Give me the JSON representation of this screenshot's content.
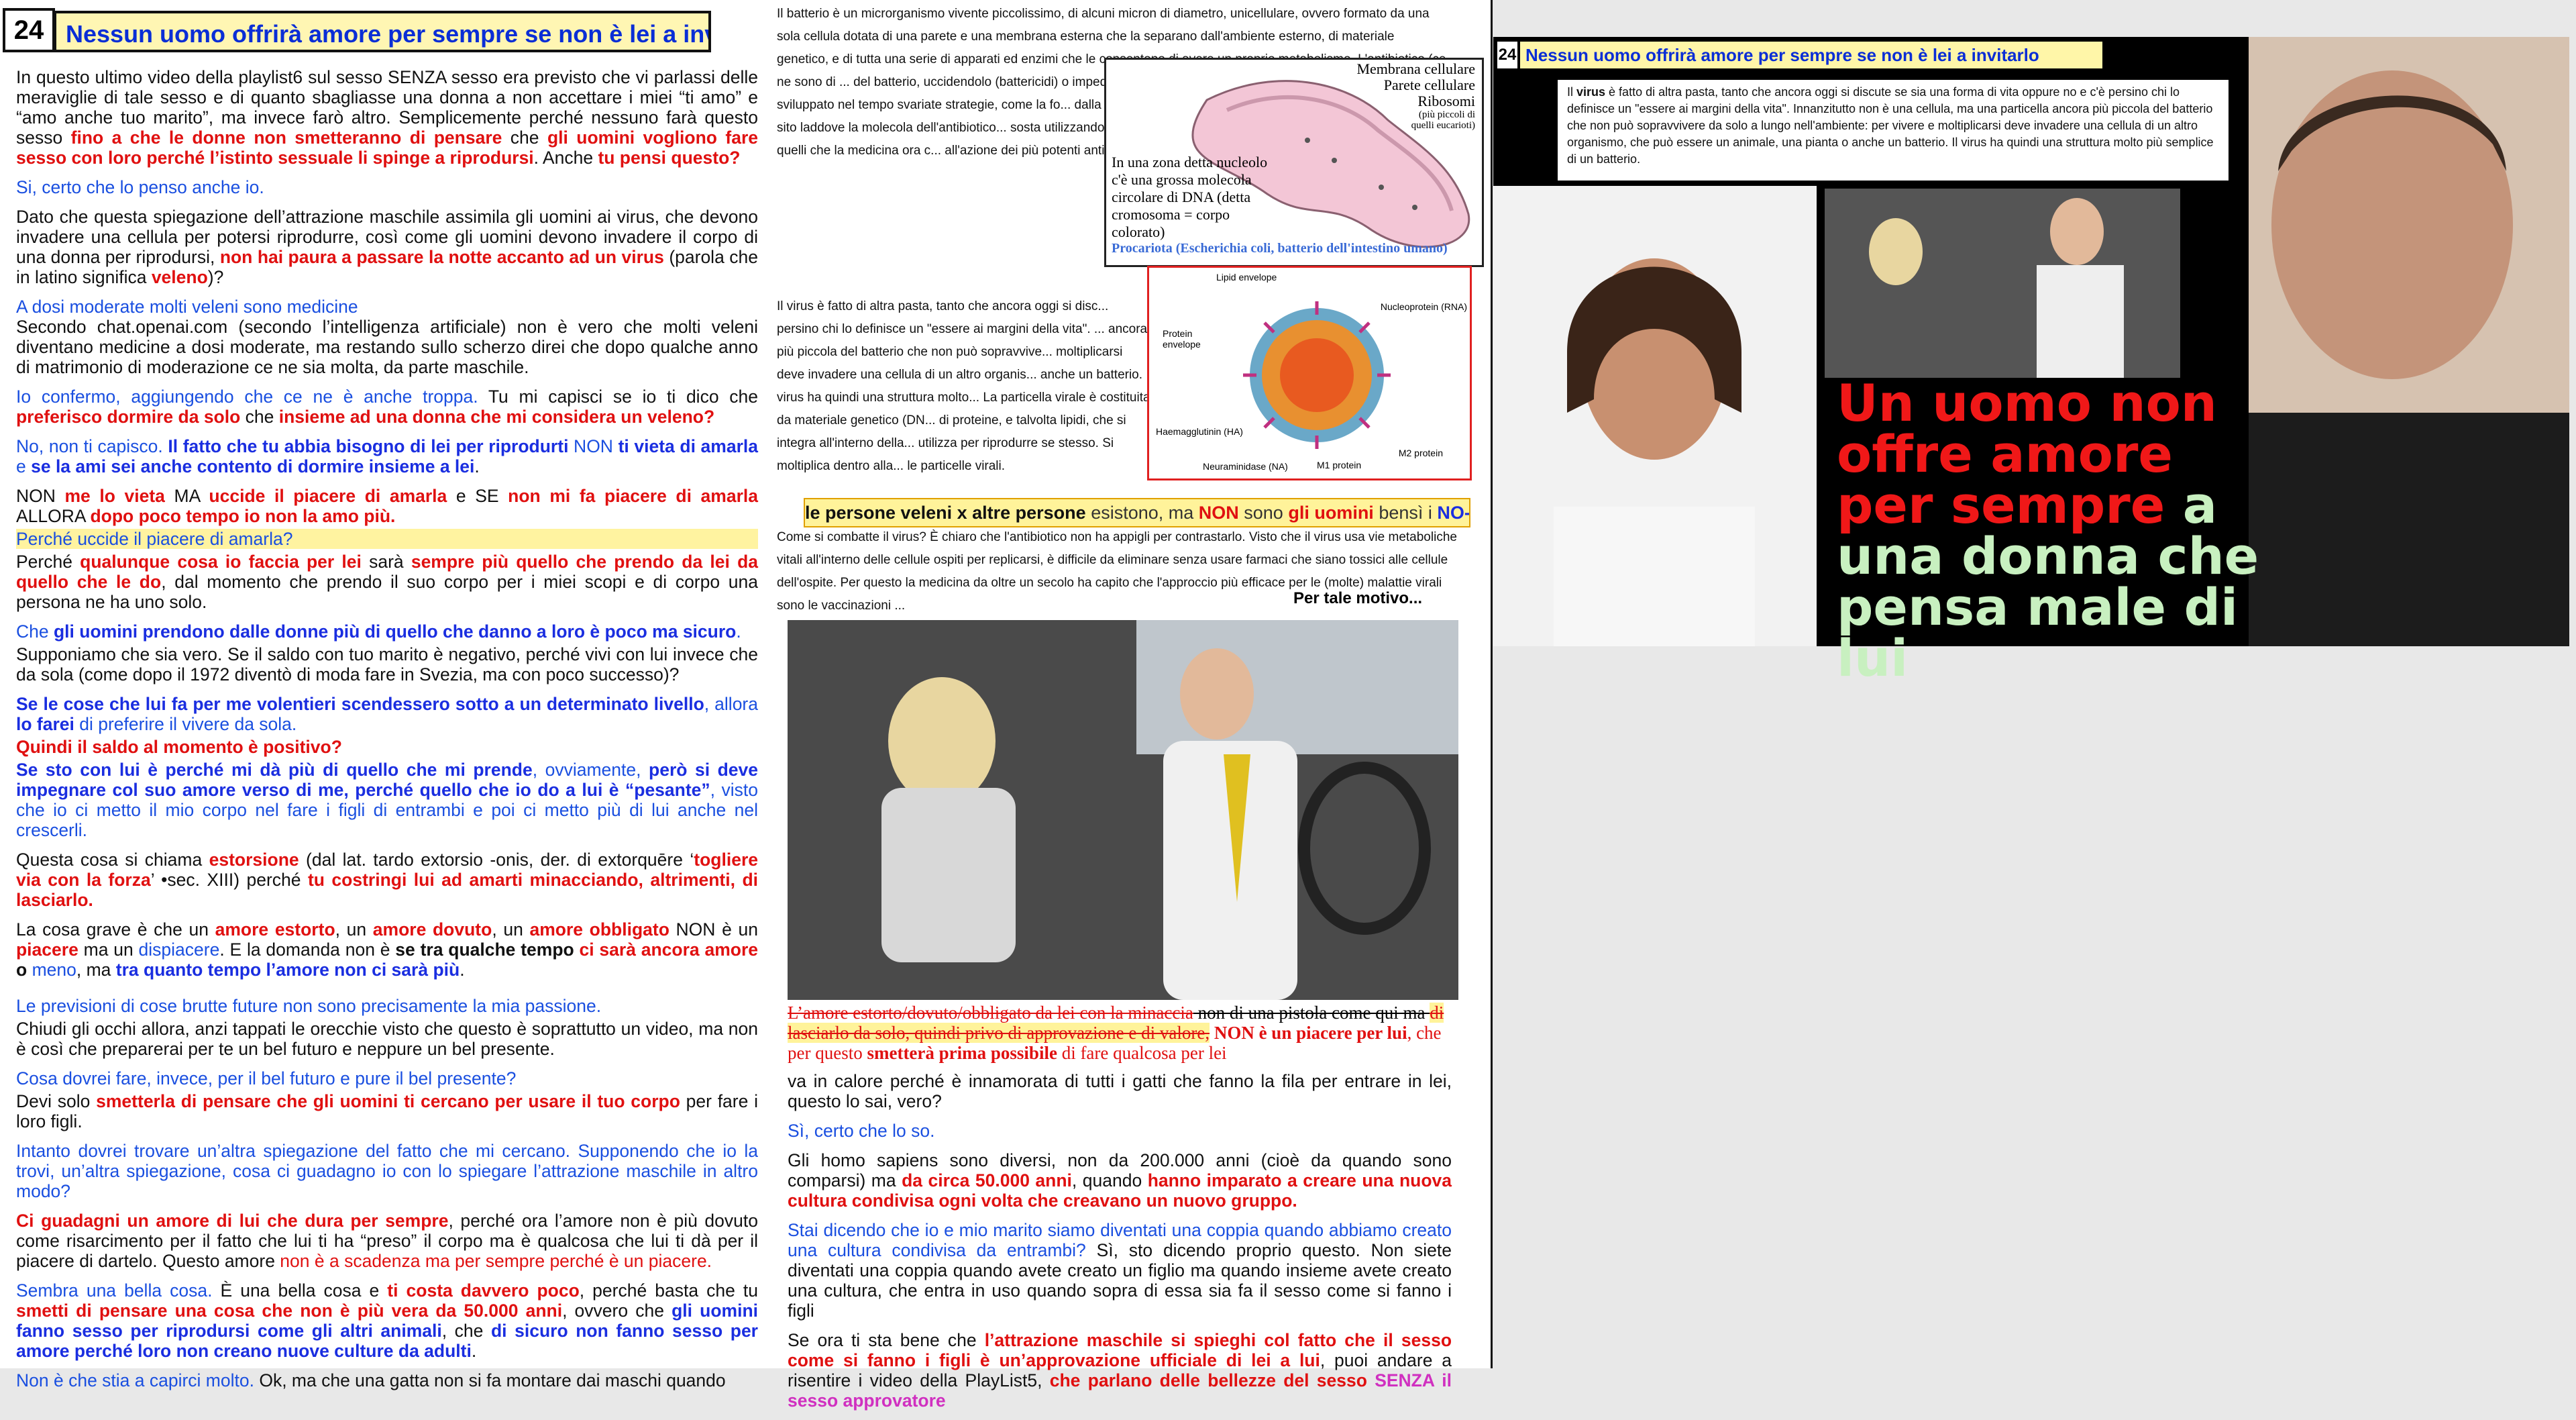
{
  "slide_number": "24",
  "title": "Nessun uomo offrirà amore per sempre se non è lei a invitarlo",
  "col1": {
    "p1_a": "In questo ultimo video della playlist6 sul sesso SENZA sesso era previsto che vi parlassi delle meraviglie di tale sesso e di quanto sbagliasse una donna a non accettare i miei “ti amo” e “amo anche tuo marito”, ma invece farò altro. Semplicemente perché nessuno farà questo sesso ",
    "p1_b": "fino a che le donne non smetteranno di pensare",
    "p1_c": " che ",
    "p1_d": "gli uomini vogliono fare sesso con loro perché l’istinto sessuale li spinge a riprodursi",
    "p1_e": ". Anche ",
    "p1_f": "tu pensi questo?",
    "q1": "Si, certo che lo penso anche io.",
    "p2_a": "Dato che questa spiegazione dell’attrazione maschile assimila gli uomini ai virus, che devono invadere una cellula per potersi riprodurre, così come gli uomini devono invadere il corpo di una donna per riprodursi, ",
    "p2_b": "non hai paura a passare la notte accanto ad un virus",
    "p2_c": " (parola che in latino significa ",
    "p2_d": "veleno",
    "p2_e": ")?",
    "q2": "A dosi moderate molti veleni sono medicine",
    "p3": "Secondo chat.openai.com (secondo l’intelligenza artificiale) non è vero che molti veleni diventano medicine a dosi moderate, ma restando sullo scherzo direi che dopo qualche anno di matrimonio di moderazione ce ne sia molta, da parte maschile.",
    "p4_a": "Io confermo, aggiungendo che ce ne è anche troppa.",
    "p4_b": " Tu mi capisci se io ti dico che ",
    "p4_c": "preferisco dormire da solo",
    "p4_d": " che ",
    "p4_e": "insieme ad una donna che mi considera un veleno?",
    "p5_a": "No, non ti capisco. ",
    "p5_b": "Il fatto che tu abbia bisogno di lei per riprodurti",
    "p5_c": " NON ",
    "p5_d": "ti vieta di amarla",
    "p5_e": " e ",
    "p5_f": "se la ami sei anche contento di dormire insieme a lei",
    "p5_g": ".",
    "p6_a": "NON ",
    "p6_b": "me lo vieta",
    "p6_c": " MA ",
    "p6_d": "uccide il piacere di amarla",
    "p6_e": " e SE ",
    "p6_f": "non mi fa piacere di amarla",
    "p6_g": " ALLORA ",
    "p6_h": "dopo poco tempo io non la amo più.",
    "q3": "Perché uccide il piacere di amarla?",
    "p7_a": "Perché ",
    "p7_b": "qualunque cosa io faccia per lei",
    "p7_c": " sarà ",
    "p7_d": "sempre più quello che prendo da lei da quello che le do",
    "p7_e": ", dal momento che prendo il suo corpo per i miei scopi e di corpo una persona ne ha uno solo.",
    "q4_a": "Che ",
    "q4_b": "gli uomini prendono dalle donne più di quello che danno a loro è poco ma sicuro",
    "q4_c": ".",
    "p8": "Supponiamo che sia vero. Se il saldo con tuo marito è negativo, perché vivi con lui invece che da sola (come dopo il 1972 diventò di moda fare in Svezia, ma con poco successo)?",
    "p9_a": "Se le cose che lui fa per me volentieri scendessero sotto a un determinato livello",
    "p9_b": ", allora ",
    "p9_c": "lo farei",
    "p9_d": " di preferire il vivere da sola.",
    "q5": "Quindi il saldo al momento è positivo?",
    "p10_a": "Se sto con lui è perché mi dà più di quello che mi prende",
    "p10_b": ", ovviamente, ",
    "p10_c": "però si deve impegnare col suo amore verso di me, perché quello che io do a lui è “pesante”",
    "p10_d": ", visto che io ci metto il mio corpo nel fare i figli di entrambi e poi ci metto più di lui anche nel crescerli.",
    "p11_a": "Questa cosa si chiama ",
    "p11_b": "estorsione",
    "p11_c": " (dal lat. tardo extorsio -onis, der. di extorquēre ‘",
    "p11_d": "togliere via con la forza",
    "p11_e": "’ •sec. XIII) perché ",
    "p11_f": "tu costringi lui ad amarti minacciando, altrimenti, di lasciarlo.",
    "p12_a": "La cosa grave è che un ",
    "p12_b": "amore estorto",
    "p12_c": ", un ",
    "p12_d": "amore dovuto",
    "p12_e": ", un ",
    "p12_f": "amore obbligato",
    "p12_g": " NON è un ",
    "p12_h": "piacere",
    "p12_i": " ma un ",
    "p12_j": "dispiacere",
    "p12_k": ". E la domanda non è ",
    "p12_l": "se tra qualche tempo",
    "p12_m": " ",
    "p12_n": "ci sarà ancora amore",
    "p12_o": " o ",
    "p12_p": "meno",
    "p12_q": ", ma ",
    "p12_r": "tra quanto tempo l’amore non ci sarà più",
    "p12_s": ".",
    "q6": "Le previsioni di cose brutte future non sono precisamente la mia passione.",
    "p13": "Chiudi gli occhi allora, anzi tappati le orecchie visto che questo è soprattutto un video, ma non è così che preparerai per te un bel futuro e neppure un bel presente.",
    "q7": "Cosa dovrei fare, invece, per il bel futuro e pure il bel presente?",
    "p14_a": "Devi solo ",
    "p14_b": "smetterla di pensare che gli uomini ti cercano per usare il tuo corpo",
    "p14_c": " per fare i loro figli.",
    "q8": "Intanto dovrei trovare un’altra spiegazione del fatto che mi cercano. Supponendo che io la trovi, un’altra spiegazione, cosa ci guadagno io con lo spiegare l’attrazione maschile in altro modo?",
    "p15_a": "Ci guadagni un amore di lui che dura per sempre",
    "p15_b": ", perché ora l’amore non è più dovuto come risarcimento per il fatto che lui ti ha “preso” il corpo ma è qualcosa che lui ti dà per il piacere di dartelo. Questo amore ",
    "p15_c": "non è a scadenza ma per sempre perché è un piacere.",
    "q9_a": "Sembra una bella cosa.",
    "q9_b": " È una bella cosa e ",
    "q9_c": "ti costa davvero poco",
    "q9_d": ", perché basta che tu ",
    "q9_e": "smetti di pensare una cosa che non è più vera da 50.000 anni",
    "q9_f": ", ovvero che ",
    "q9_g": "gli uomini fanno sesso per riprodursi come gli altri animali",
    "q9_h": ", che ",
    "q9_i": "di sicuro non fanno sesso per amore perché loro non creano nuove culture da adulti",
    "q9_j": ".",
    "q10_a": "Non è che stia a capirci molto.",
    "q10_b": "  Ok, ma che una gatta non si fa montare dai maschi quando"
  },
  "col2": {
    "bact_text": "Il batterio è un microrganismo vivente piccolissimo, di alcuni micron di diametro, unicellulare, ovvero formato da una sola cellula dotata di una parete e una membrana esterna che la separano dall'ambiente esterno, di materiale genetico, e di tutta una serie di apparati ed enzimi che le consentono di avere un proprio metabolismo. L'antibiotico (ce ne sono di ... del batterio, uccidendolo (battericidi) o impedendo ... Per contro il batterio mette in atto delle difese. Ba... sviluppato nel tempo svariate strategie, come la fo... dalla cellula l'antibiotico, mentre altri ne disattivan... bloccano il sito laddove la molecola dell'antibiotico... sosta utilizzando strategie e controstrategie molto... antibiotici ha prodotto quelli che la medicina ora c... all'azione dei più potenti antibiotici.",
    "bact_labels": {
      "membrana": "Membrana cellulare",
      "parete": "Parete cellulare",
      "ribosomi": "Ribosomi",
      "ribosomi_note": "(più piccoli di quelli eucarioti)",
      "nucleo": "In una zona detta nucleolo c'è una grossa molecola circolare di DNA (detta cromosoma = corpo colorato)",
      "caption": "Procariota (Escherichia coli, batterio dell'intestino umano)"
    },
    "virus_text": "Il virus è fatto di altra pasta, tanto che ancora oggi si disc... persino chi lo definisce un \"essere ai margini della vita\". ... ancora più piccola del batterio che non può sopravvive... moltiplicarsi deve invadere una cellula di un altro organis... anche un batterio. Il virus ha quindi una struttura molto... La particella virale è costituita da materiale genetico (DN... di proteine, e talvolta lipidi, che si integra all'interno della... utilizza per riprodurre se stesso. Si moltiplica dentro alla... le particelle virali.",
    "virus_labels": [
      "Lipid envelope",
      "Nucleoprotein (RNA)",
      "Protein envelope",
      "Haemagglutinin (HA)",
      "Neuraminidase (NA)",
      "M1 protein",
      "M2 protein"
    ],
    "banner_a": "le persone veleni x altre persone",
    "banner_b": " esistono, ma ",
    "banner_c": "NON",
    "banner_d": " sono ",
    "banner_e": "gli uomini",
    "banner_f": " bensì i ",
    "banner_g": "NO-VAX",
    "cure_text": "Come si combatte il virus? È chiaro che l'antibiotico non ha appigli per contrastarlo. Visto che il virus usa vie metaboliche vitali all'interno delle cellule ospiti per replicarsi, è difficile da eliminare senza usare farmaci che siano tossici alle cellule dell'ospite. Per questo la medicina da oltre un secolo ha capito che l'approccio più efficace per le (molte) malattie virali sono le vaccinazioni ...",
    "per_tale": "Per tale motivo...",
    "strike_a": "L’amore estorto/dovuto/obbligato da lei con la minaccia",
    "strike_b": " non di una pistola come qui ma ",
    "strike_c": "di lasciarlo da solo, quindi privo di approvazione e di valore,",
    "strike_d": " NON è un piacere per lui",
    "strike_e": ", che per questo ",
    "strike_f": "smetterà prima possibile",
    "strike_g": " di fare qualcosa per lei",
    "p1": "va in calore perché è innamorata di tutti i gatti che fanno la fila per entrare in lei, questo lo sai, vero?",
    "q1": "Sì, certo che lo so.",
    "p2_a": "Gli homo sapiens sono diversi, non da 200.000 anni (cioè da quando sono comparsi) ma ",
    "p2_b": "da circa 50.000 anni",
    "p2_c": ", quando ",
    "p2_d": "hanno imparato a creare una nuova cultura condivisa  ogni volta che creavano un nuovo gruppo.",
    "q2_a": "Stai dicendo che io e mio marito siamo diventati una coppia quando abbiamo creato una cultura condivisa da entrambi?",
    "q2_b": " Sì, sto dicendo proprio questo. Non siete diventati una coppia quando avete creato un figlio ma quando insieme avete creato una cultura, che entra in uso quando sopra di essa sia fa il sesso come si fanno i figli",
    "p3_a": "Se ora ti sta bene che ",
    "p3_b": "l’attrazione maschile si spieghi col fatto che il sesso come si fanno i figli è un’approvazione ufficiale di lei a lui",
    "p3_c": ", puoi andare a risentire i video della PlayList5, ",
    "p3_d": "che parlano delle bellezze del sesso ",
    "p3_e": "SENZA il sesso approvatore"
  },
  "right_panel": {
    "number": "24",
    "title": "Nessun uomo offrirà amore per sempre se non è lei a invitarlo",
    "virus_text_a": "Il ",
    "virus_text_b": "virus",
    "virus_text_c": " è fatto di altra pasta, tanto che ancora oggi si discute se sia una forma di vita oppure no e c'è persino chi lo definisce un \"essere ai margini della vita\". Innanzitutto non è una cellula, ma una particella ancora più piccola del batterio che non può sopravvivere da solo a lungo nell'ambiente: per vivere e moltiplicarsi deve invadere una cellula di un altro organismo, che può essere un animale, una pianta o anche un batterio. Il virus ha quindi una struttura molto più semplice di un batterio.",
    "big_red": "Un uomo non offre amore per sempre",
    "big_green": " a una donna che pensa male di lui"
  },
  "colors": {
    "blue": "#1a4fe0",
    "red": "#e01010",
    "title_bg": "#fff6b3",
    "green_text": "#c8f0c0"
  }
}
